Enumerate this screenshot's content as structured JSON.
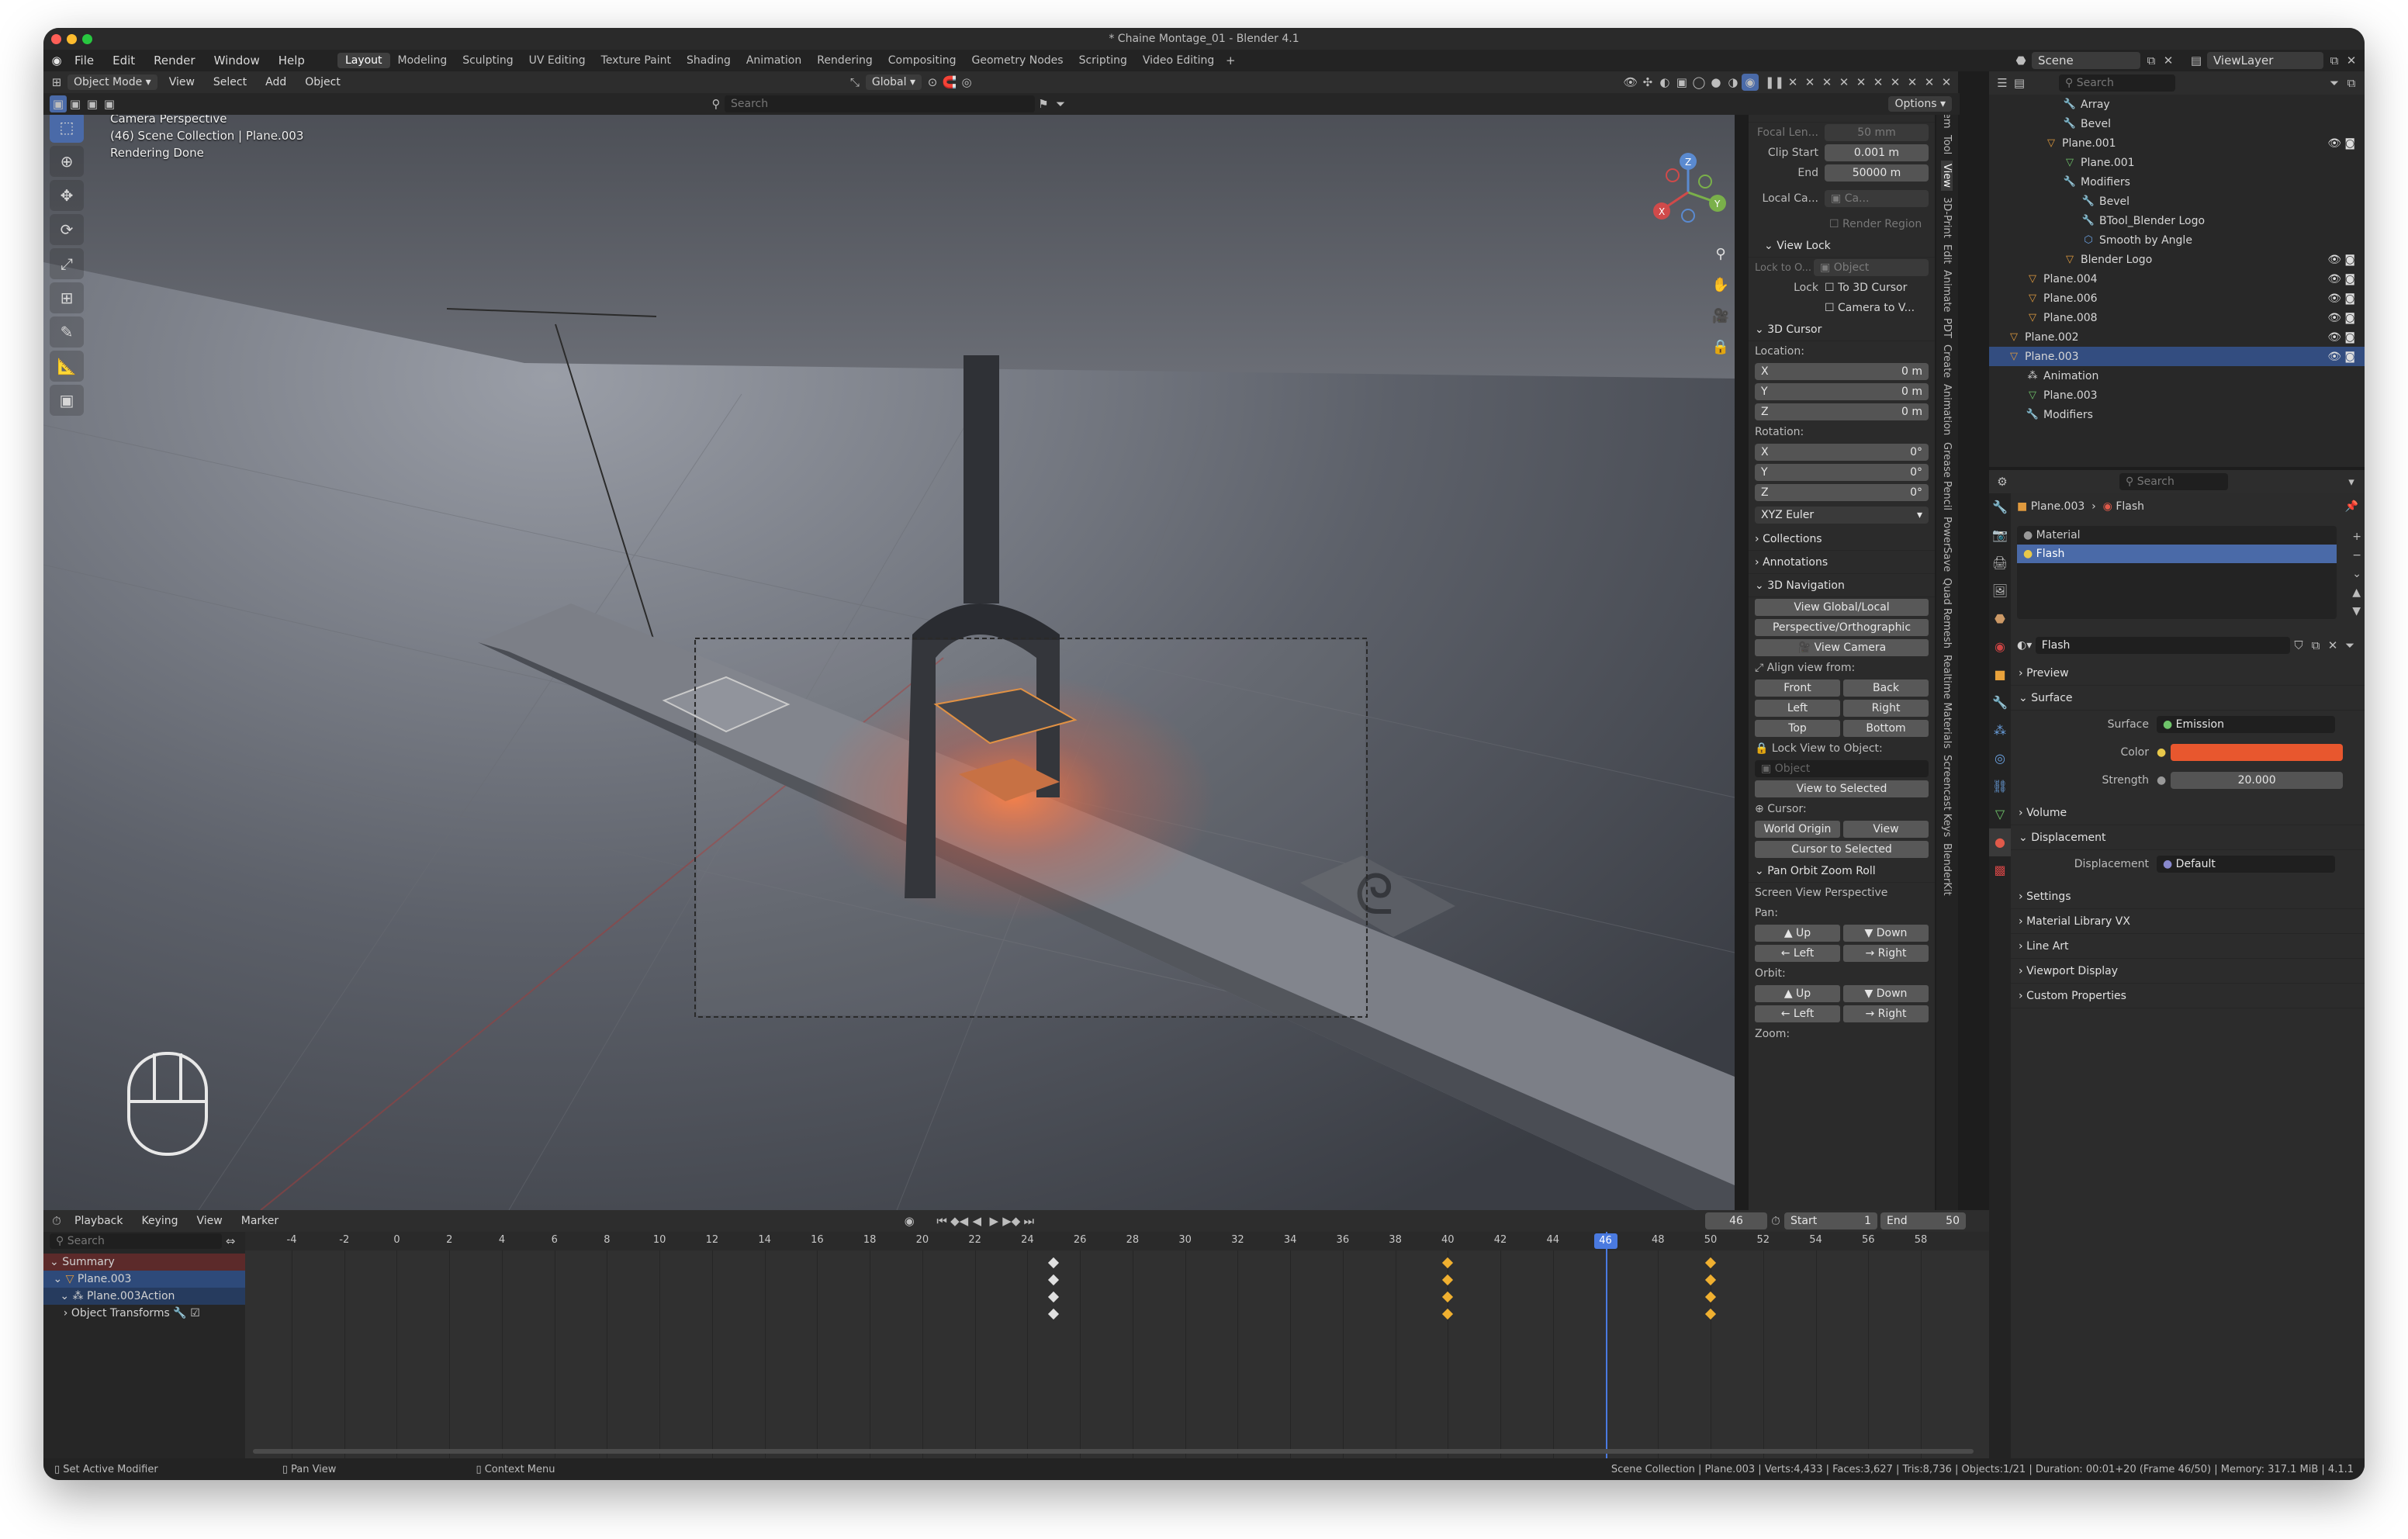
{
  "window": {
    "title": "* Chaine Montage_01 - Blender 4.1"
  },
  "menu": {
    "items": [
      "File",
      "Edit",
      "Render",
      "Window",
      "Help"
    ]
  },
  "workspaces": [
    "Layout",
    "Modeling",
    "Sculpting",
    "UV Editing",
    "Texture Paint",
    "Shading",
    "Animation",
    "Rendering",
    "Compositing",
    "Geometry Nodes",
    "Scripting",
    "Video Editing"
  ],
  "scene": {
    "name": "Scene",
    "view_layer": "ViewLayer"
  },
  "viewport_header": {
    "mode": "Object Mode",
    "menus": [
      "View",
      "Select",
      "Add",
      "Object"
    ],
    "orientation": "Global",
    "search_placeholder": "Search",
    "options": "Options"
  },
  "overlay": {
    "line1": "Camera Perspective",
    "line2": "(46) Scene Collection | Plane.003",
    "line3": "Rendering Done"
  },
  "npanel": {
    "view_title": "View",
    "focal_label": "Focal Len...",
    "focal_value": "50 mm",
    "clip_start_label": "Clip Start",
    "clip_start_value": "0.001 m",
    "end_label": "End",
    "end_value": "50000 m",
    "local_cam_label": "Local Ca...",
    "local_cam_value": "Ca...",
    "render_region": "Render Region",
    "view_lock_title": "View Lock",
    "lock_to_obj_label": "Lock to O...",
    "lock_to_obj_value": "Object",
    "lock_label": "Lock",
    "to_3d_cursor": "To 3D Cursor",
    "camera_to_view": "Camera to V...",
    "cursor_title": "3D Cursor",
    "location_label": "Location:",
    "x_label": "X",
    "y_label": "Y",
    "z_label": "Z",
    "loc_x": "0 m",
    "loc_y": "0 m",
    "loc_z": "0 m",
    "rotation_label": "Rotation:",
    "rot_x": "0°",
    "rot_y": "0°",
    "rot_z": "0°",
    "rot_mode": "XYZ Euler",
    "collections": "Collections",
    "annotations": "Annotations",
    "nav_title": "3D Navigation",
    "view_global_local": "View Global/Local",
    "persp_ortho": "Perspective/Orthographic",
    "view_camera": "View Camera",
    "align_view": "Align view from:",
    "front": "Front",
    "back": "Back",
    "left": "Left",
    "right": "Right",
    "top": "Top",
    "bottom": "Bottom",
    "lock_view_obj": "Lock View to Object:",
    "object_placeholder": "Object",
    "view_to_selected": "View to Selected",
    "cursor_label": "Cursor:",
    "world_origin": "World Origin",
    "view_btn": "View",
    "cursor_to_selected": "Cursor to Selected",
    "pozr_title": "Pan Orbit Zoom Roll",
    "screen_view": "Screen View Perspective",
    "pan_label": "Pan:",
    "orbit_label": "Orbit:",
    "zoom_label": "Zoom:",
    "up": "Up",
    "down": "Down"
  },
  "side_tabs": [
    "Item",
    "Tool",
    "View",
    "3D-Print",
    "Edit",
    "Animate",
    "PDT",
    "Create",
    "Animation",
    "Grease Pencil",
    "PowerSave",
    "Quad Remesh",
    "Realtime Materials",
    "Screencast Keys",
    "BlenderKit"
  ],
  "outliner": {
    "search_placeholder": "Search",
    "rows": [
      {
        "label": "Array",
        "indent": 3,
        "icon": "wrench"
      },
      {
        "label": "Bevel",
        "indent": 3,
        "icon": "wrench"
      },
      {
        "label": "Plane.001",
        "indent": 2,
        "icon": "mesh-obj"
      },
      {
        "label": "Plane.001",
        "indent": 3,
        "icon": "mesh"
      },
      {
        "label": "Modifiers",
        "indent": 3,
        "icon": "wrench"
      },
      {
        "label": "Bevel",
        "indent": 4,
        "icon": "wrench"
      },
      {
        "label": "BTool_Blender Logo",
        "indent": 4,
        "icon": "wrench"
      },
      {
        "label": "Smooth by Angle",
        "indent": 4,
        "icon": "node"
      },
      {
        "label": "Blender Logo",
        "indent": 3,
        "icon": "mesh-obj"
      },
      {
        "label": "Plane.004",
        "indent": 1,
        "icon": "mesh-obj"
      },
      {
        "label": "Plane.006",
        "indent": 1,
        "icon": "mesh-obj"
      },
      {
        "label": "Plane.008",
        "indent": 1,
        "icon": "mesh-obj"
      },
      {
        "label": "Plane.002",
        "indent": 0,
        "icon": "mesh-obj"
      },
      {
        "label": "Plane.003",
        "indent": 0,
        "icon": "mesh-obj",
        "selected": true
      },
      {
        "label": "Animation",
        "indent": 1,
        "icon": "anim"
      },
      {
        "label": "Plane.003",
        "indent": 1,
        "icon": "mesh"
      },
      {
        "label": "Modifiers",
        "indent": 1,
        "icon": "wrench"
      }
    ]
  },
  "properties": {
    "search_placeholder": "Search",
    "breadcrumb_obj": "Plane.003",
    "breadcrumb_mat": "Flash",
    "slots": [
      "Material",
      "Flash"
    ],
    "material_name": "Flash",
    "preview": "Preview",
    "surface_section": "Surface",
    "surface_label": "Surface",
    "surface_value": "Emission",
    "color_label": "Color",
    "color_hex": "#e8572e",
    "strength_label": "Strength",
    "strength_value": "20.000",
    "volume": "Volume",
    "displacement_section": "Displacement",
    "displacement_label": "Displacement",
    "displacement_value": "Default",
    "settings": "Settings",
    "material_library": "Material Library VX",
    "line_art": "Line Art",
    "viewport_display": "Viewport Display",
    "custom_properties": "Custom Properties"
  },
  "timeline": {
    "menus": [
      "Playback",
      "Keying",
      "View",
      "Marker"
    ],
    "current_frame": "46",
    "start_label": "Start",
    "start_value": "1",
    "end_label": "End",
    "end_value": "50",
    "search_placeholder": "Search",
    "ruler": [
      "-4",
      "-2",
      "0",
      "2",
      "4",
      "6",
      "8",
      "10",
      "12",
      "14",
      "16",
      "18",
      "20",
      "22",
      "24",
      "26",
      "28",
      "30",
      "32",
      "34",
      "36",
      "38",
      "40",
      "42",
      "44",
      "46",
      "48",
      "50",
      "52",
      "54",
      "56",
      "58"
    ],
    "channels": [
      "Summary",
      "Plane.003",
      "Plane.003Action",
      "Object Transforms"
    ],
    "keyframes": [
      25,
      40,
      50
    ]
  },
  "statusbar": {
    "left1": "Set Active Modifier",
    "left2": "Pan View",
    "left3": "Context Menu",
    "right": "Scene Collection | Plane.003 | Verts:4,433 | Faces:3,627 | Tris:8,736 | Objects:1/21 | Duration: 00:01+20 (Frame 46/50) | Memory: 317.1 MiB | 4.1.1"
  }
}
